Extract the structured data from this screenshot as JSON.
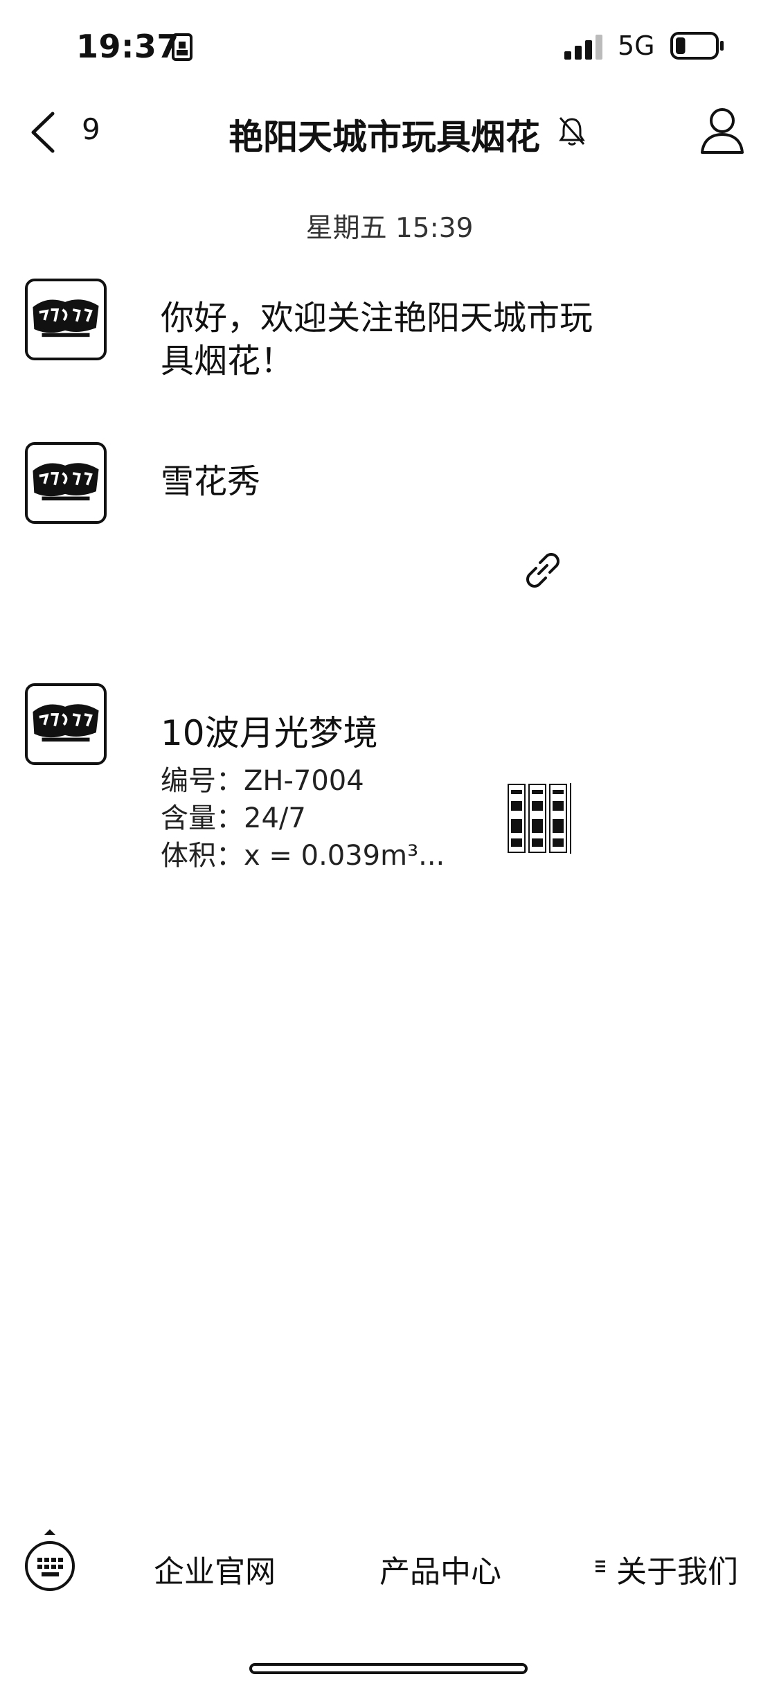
{
  "status_bar": {
    "time": "19:37",
    "network": "5G",
    "battery_level": 0.25
  },
  "nav": {
    "back_count": "9",
    "title": "艳阳天城市玩具烟花"
  },
  "chat": {
    "timestamp": "星期五 15:39",
    "messages": [
      {
        "text_line1": "你好，欢迎关注艳阳天城市玩",
        "text_line2": "具烟花！"
      },
      {
        "text": "雪花秀"
      },
      {
        "title": "10波月光梦境",
        "specs": [
          "编号：ZH-7004",
          "含量：24/7",
          "体积：x = 0.039m³..."
        ]
      }
    ]
  },
  "menu": {
    "items": [
      "企业官网",
      "产品中心",
      "关于我们"
    ]
  }
}
